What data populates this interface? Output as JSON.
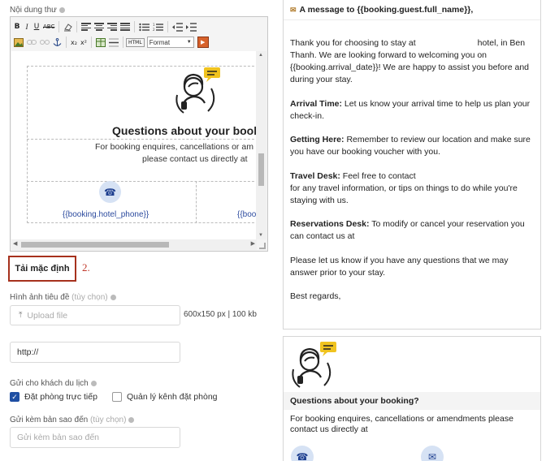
{
  "form": {
    "content_label": "Nội dung thư",
    "reset_button": "Tải mặc định",
    "step_marker": "2.",
    "header_image_label": "Hình ảnh tiêu đề",
    "header_image_optional": "(tùy chọn)",
    "upload_placeholder": "Upload file",
    "upload_hint": "600x150 px | 100 kb",
    "url_value": "http://",
    "send_to_label": "Gửi cho khách du lịch",
    "checkbox_direct": "Đặt phòng trực tiếp",
    "checkbox_direct_checked": true,
    "checkbox_channel": "Quản lý kênh đặt phòng",
    "checkbox_channel_checked": false,
    "cc_label": "Gửi kèm bản sao đến",
    "cc_optional": "(tùy chọn)",
    "cc_placeholder": "Gửi kèm bản sao đến"
  },
  "toolbar": {
    "row1": [
      "B",
      "I",
      "U",
      "ABC"
    ],
    "row2_sup_sub": [
      "x₂",
      "x²"
    ],
    "html_label": "HTML",
    "format_select": "Format"
  },
  "editor": {
    "title": "Questions about your booki",
    "text1": "For booking enquires, cancellations or am",
    "text2": "please contact us directly at",
    "phone_placeholder": "{{booking.hotel_phone}}",
    "phone_placeholder_cut": "{{boo"
  },
  "preview": {
    "header": "A message to {{booking.guest.full_name}},",
    "intro_1": "Thank you for choosing to stay at",
    "intro_2": "hotel, in Ben Thanh. We are looking forward to welcoming you on {{booking.arrival_date}}! We are happy to assist you before and during your stay.",
    "arrival_label": "Arrival Time:",
    "arrival_text": "Let us know your arrival time to help us plan your check-in.",
    "getting_label": "Getting Here:",
    "getting_text": "Remember to review our location and make sure you have our booking voucher with you.",
    "travel_label": "Travel Desk:",
    "travel_text_1": "Feel free to contact",
    "travel_text_2": "for any travel information, or tips on things to do while you're staying with us.",
    "reservations_label": "Reservations Desk:",
    "reservations_text": "To modify or cancel your reservation you can contact us at",
    "closing": "Please let us know if you have any questions that we may answer prior to your stay.",
    "regards": "Best regards,",
    "support_title": "Questions about your booking?",
    "support_text": "For booking enquires, cancellations or amendments please contact us directly at"
  },
  "icons": {
    "phone": "phone-icon",
    "email": "mail-icon",
    "support": "support-agent-icon",
    "upload": "upload-icon",
    "envelope": "envelope-icon"
  },
  "colors": {
    "accent_blue": "#1f4fa3",
    "reset_border": "#a6311d",
    "step_marker": "#c0392b",
    "icon_bg": "#d6e2f4",
    "chat_bubble": "#f0c31f"
  }
}
